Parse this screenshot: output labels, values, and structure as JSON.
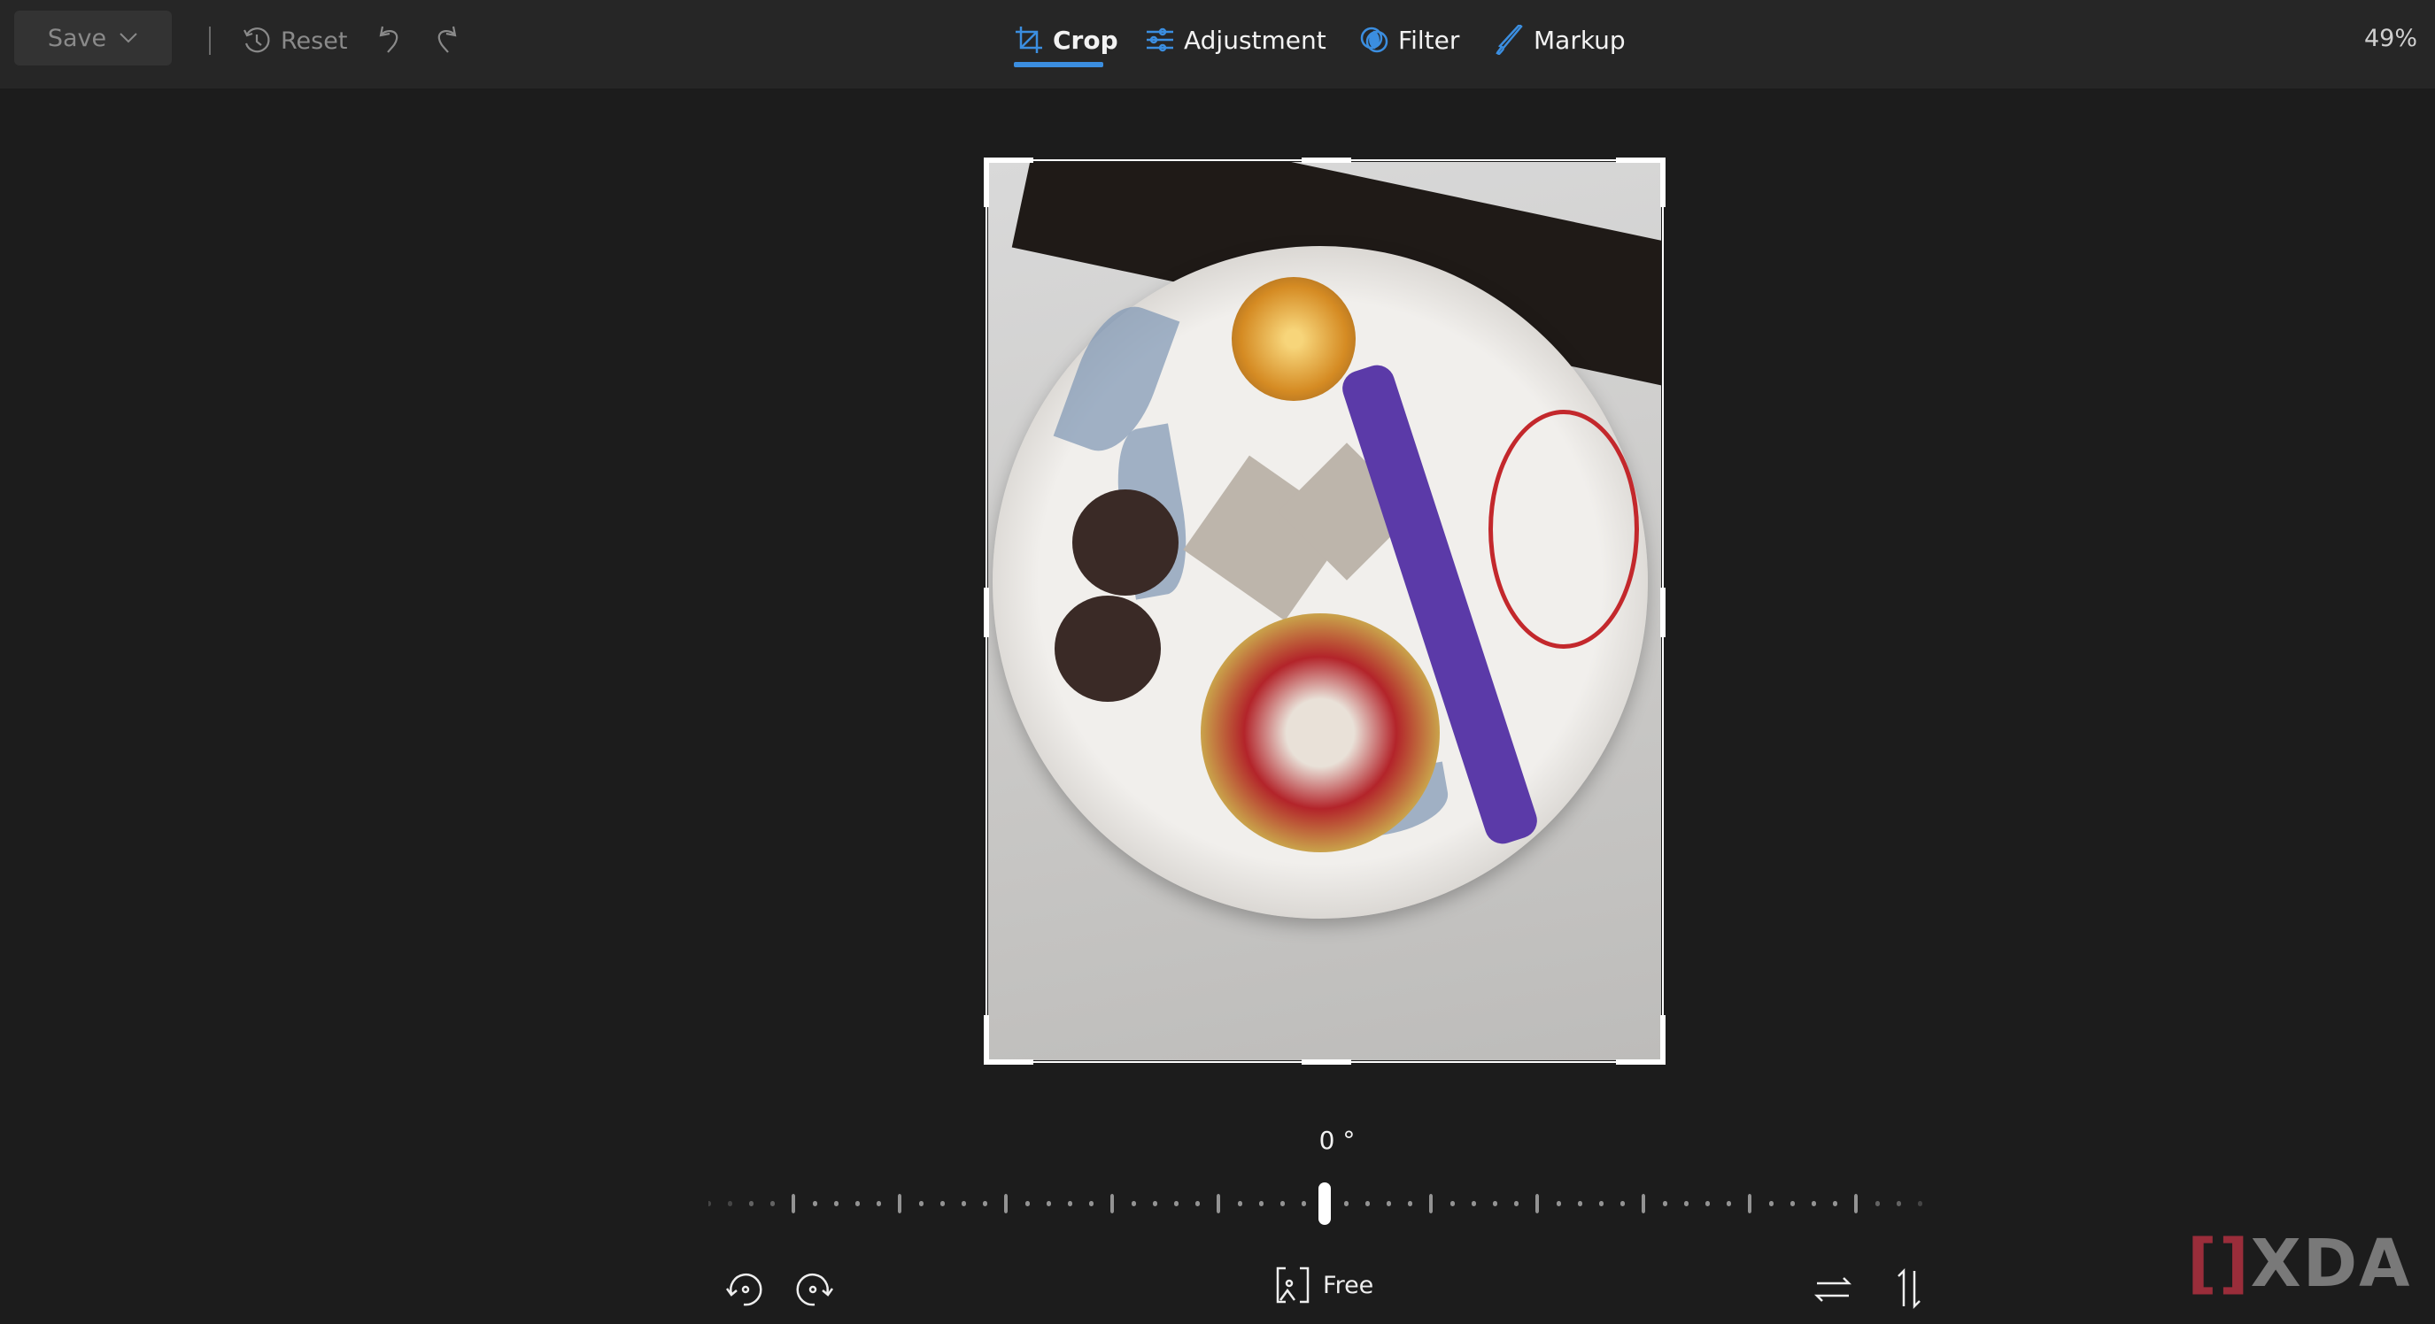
{
  "toolbar": {
    "save_label": "Save",
    "reset_label": "Reset",
    "zoom_level": "49%"
  },
  "tabs": [
    {
      "label": "Crop",
      "icon": "crop-icon",
      "active": true
    },
    {
      "label": "Adjustment",
      "icon": "sliders-icon",
      "active": false
    },
    {
      "label": "Filter",
      "icon": "filter-icon",
      "active": false
    },
    {
      "label": "Markup",
      "icon": "pen-icon",
      "active": false
    }
  ],
  "crop": {
    "rotation_label": "0 °",
    "rotation_value": 0,
    "aspect_ratio": "Free"
  },
  "colors": {
    "accent": "#3b8ee0",
    "topbar": "#262626",
    "background": "#1c1c1c"
  },
  "watermark": "XDA"
}
